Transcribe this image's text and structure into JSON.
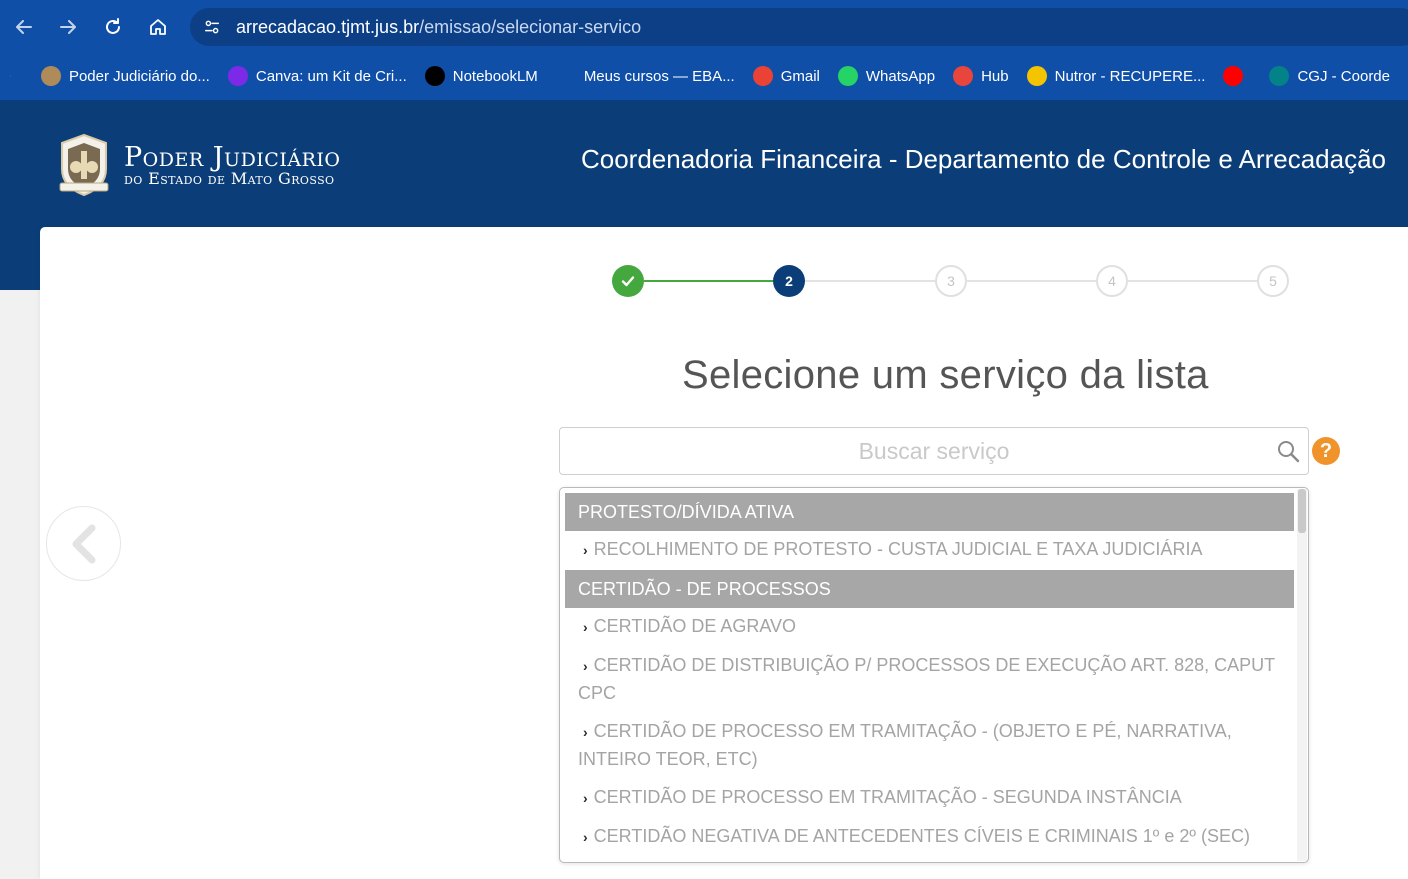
{
  "browser": {
    "url_host": "arrecadacao.tjmt.jus.br",
    "url_path": "/emissao/selecionar-servico",
    "bookmarks": [
      {
        "label": "Poder Judiciário do...",
        "icon": "tjmt-crest-icon",
        "color": "#b08b5a"
      },
      {
        "label": "Canva: um Kit de Cri...",
        "icon": "canva-icon",
        "color": "#7d2ae8"
      },
      {
        "label": "NotebookLM",
        "icon": "notebooklm-icon",
        "color": "#000000"
      },
      {
        "label": "Meus cursos — EBA...",
        "icon": "eba-icon",
        "color": "#0f4fa8"
      },
      {
        "label": "Gmail",
        "icon": "gmail-icon",
        "color": "#ea4335"
      },
      {
        "label": "WhatsApp",
        "icon": "whatsapp-icon",
        "color": "#25d366"
      },
      {
        "label": "Hub",
        "icon": "hub-flame-icon",
        "color": "#e8453c"
      },
      {
        "label": "Nutror - RECUPERE...",
        "icon": "nutror-icon",
        "color": "#f5c400"
      },
      {
        "label": "",
        "icon": "youtube-icon",
        "color": "#ff0000"
      },
      {
        "label": "CGJ - Coorde",
        "icon": "sharepoint-icon",
        "color": "#038387"
      }
    ]
  },
  "header": {
    "logo_line1": "Poder Judiciário",
    "logo_line2": "do Estado de Mato Grosso",
    "title": "Coordenadoria Financeira - Departamento de Controle e Arrecadação"
  },
  "stepper": {
    "current_step": 2,
    "steps": [
      "",
      "2",
      "3",
      "4",
      "5"
    ]
  },
  "main": {
    "title": "Selecione um serviço da lista",
    "search_placeholder": "Buscar serviço",
    "help_icon": "?"
  },
  "services": {
    "groups": [
      {
        "name": "PROTESTO/DÍVIDA ATIVA",
        "items": [
          "RECOLHIMENTO DE PROTESTO - CUSTA JUDICIAL E TAXA JUDICIÁRIA"
        ]
      },
      {
        "name": "CERTIDÃO - DE PROCESSOS",
        "items": [
          "CERTIDÃO DE AGRAVO",
          "CERTIDÃO DE DISTRIBUIÇÃO P/ PROCESSOS DE EXECUÇÃO ART. 828, CAPUT CPC",
          "CERTIDÃO DE PROCESSO EM TRAMITAÇÃO - (OBJETO E PÉ, NARRATIVA, INTEIRO TEOR, ETC)",
          "CERTIDÃO DE PROCESSO EM TRAMITAÇÃO - SEGUNDA INSTÂNCIA",
          "CERTIDÃO NEGATIVA DE ANTECEDENTES CÍVEIS E CRIMINAIS 1º e 2º (SEC)"
        ]
      }
    ]
  },
  "colors": {
    "header_bg": "#0b3e78",
    "chrome_bg": "#0f4fa8",
    "step_done": "#45a83f",
    "step_active": "#0b3e78",
    "group_header_bg": "#a7a7a7",
    "help_icon": "#f0932b"
  }
}
